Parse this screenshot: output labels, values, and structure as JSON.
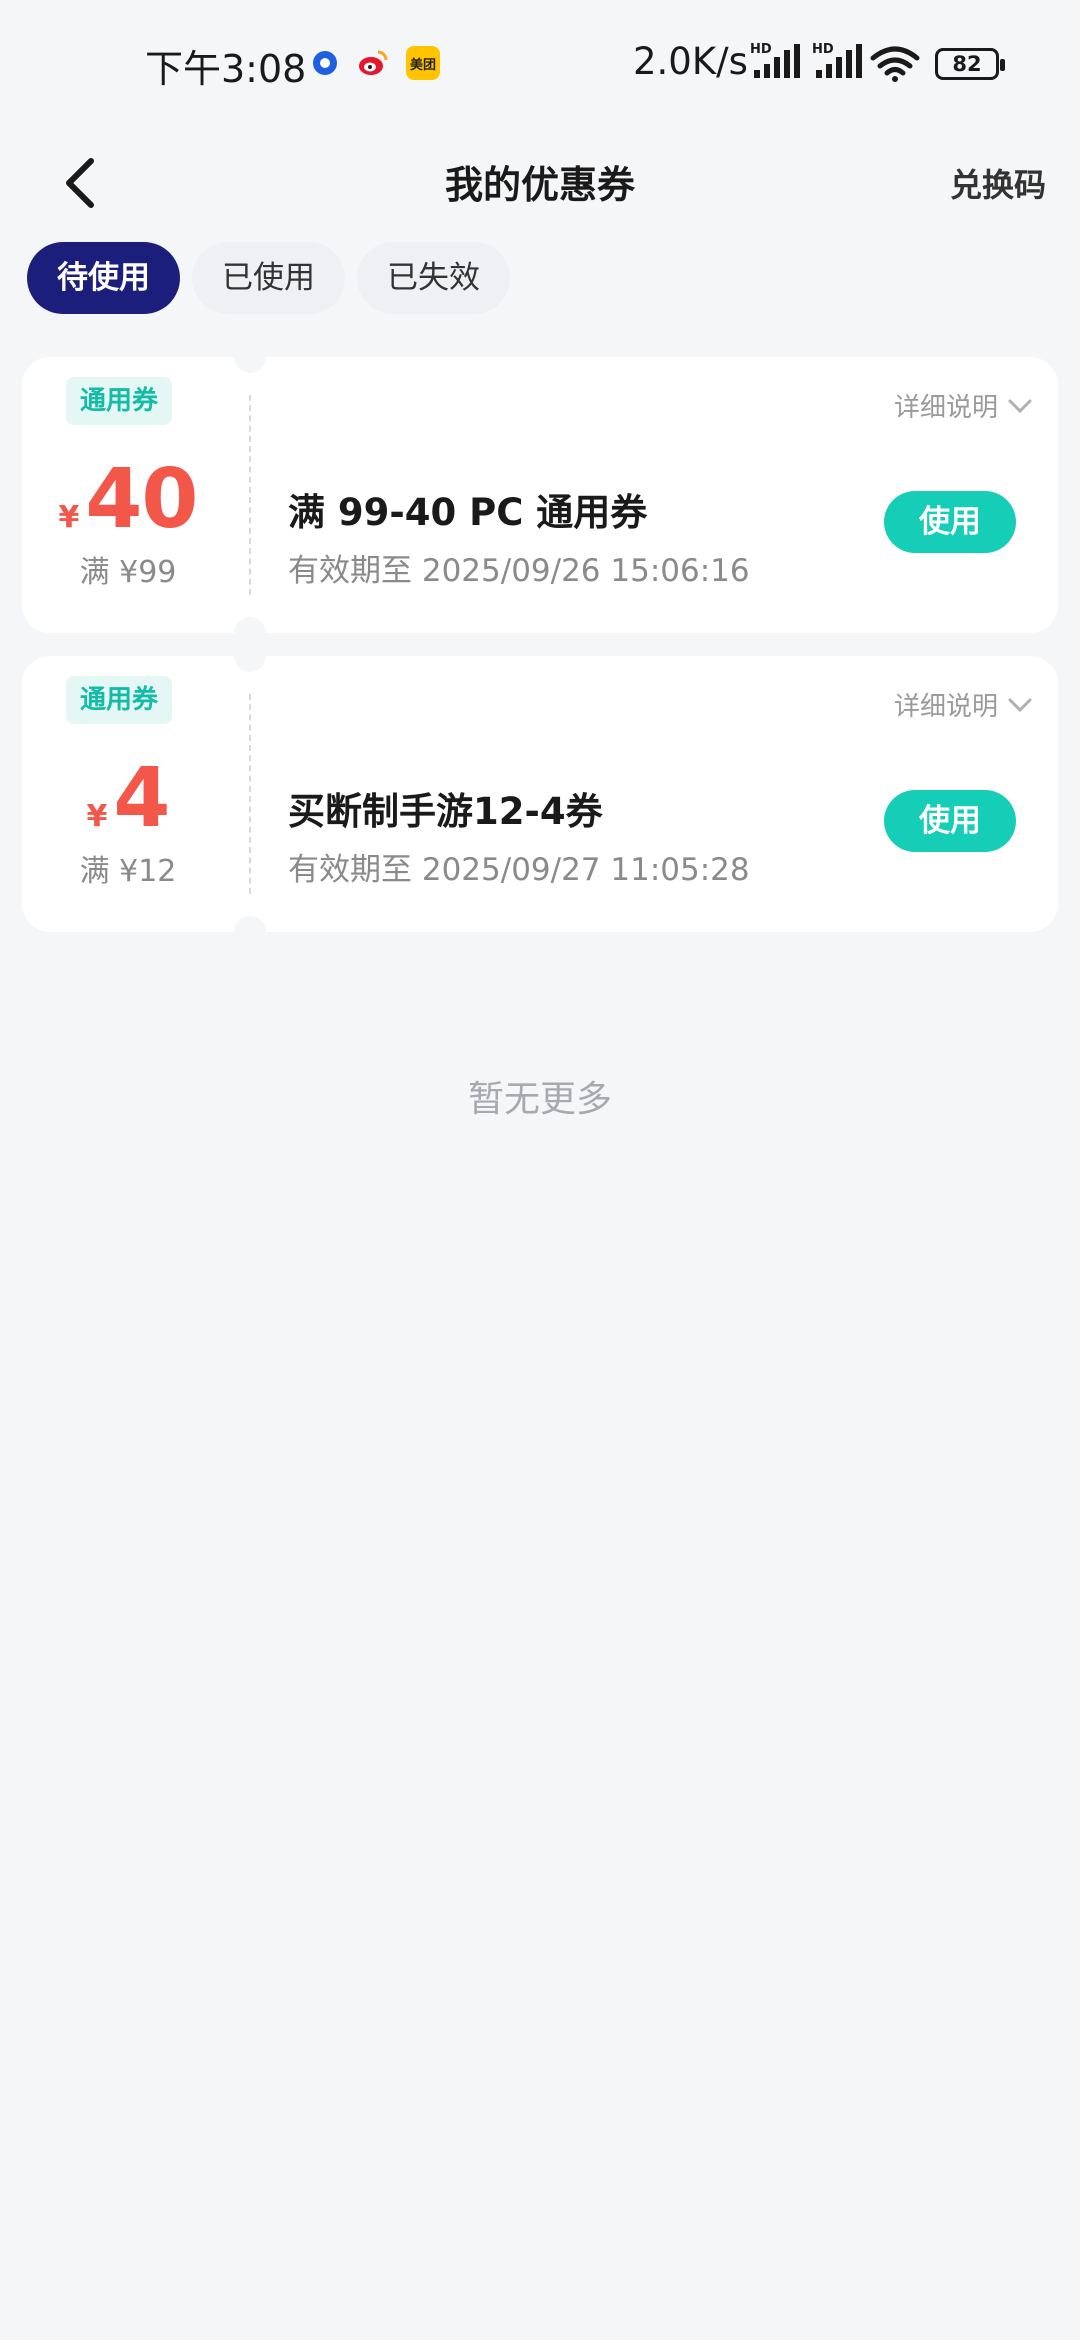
{
  "status_bar": {
    "time": "下午3:08",
    "network_speed": "2.0K/s",
    "hd_label": "HD",
    "battery": "82",
    "apps": [
      {
        "icon": "tmall-icon",
        "text": ""
      },
      {
        "icon": "weibo-icon",
        "text": ""
      },
      {
        "icon": "meituan-icon",
        "text": "美团"
      }
    ]
  },
  "header": {
    "title": "我的优惠券",
    "right_action": "兑换码"
  },
  "tabs": [
    {
      "label": "待使用",
      "active": true
    },
    {
      "label": "已使用",
      "active": false
    },
    {
      "label": "已失效",
      "active": false
    }
  ],
  "coupons": [
    {
      "badge": "通用券",
      "currency": "¥",
      "amount": "40",
      "min_spend": "满 ¥99",
      "detail_label": "详细说明",
      "title": "满 99-40 PC 通用券",
      "expiry": "有效期至 2025/09/26 15:06:16",
      "use_label": "使用"
    },
    {
      "badge": "通用券",
      "currency": "¥",
      "amount": "4",
      "min_spend": "满 ¥12",
      "detail_label": "详细说明",
      "title": "买断制手游12-4券",
      "expiry": "有效期至 2025/09/27 11:05:28",
      "use_label": "使用"
    }
  ],
  "footer_text": "暂无更多",
  "colors": {
    "tab_active": "#1c1e7c",
    "accent_teal": "#16cdb8",
    "amount_red": "#f2574a",
    "background": "#f5f6f8"
  }
}
